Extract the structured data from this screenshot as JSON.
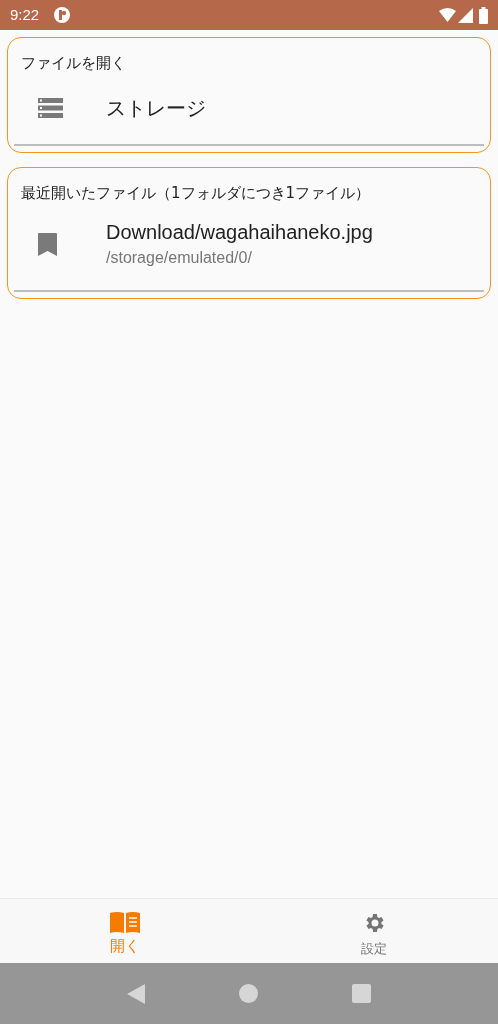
{
  "status_bar": {
    "time": "9:22"
  },
  "sections": [
    {
      "title": "ファイルを開く",
      "items": [
        {
          "kind": "storage",
          "label": "ストレージ"
        }
      ]
    },
    {
      "title": "最近開いたファイル（1フォルダにつき1ファイル）",
      "items": [
        {
          "kind": "bookmark",
          "label": "Download/wagahaihaneko.jpg",
          "sublabel": "/storage/emulated/0/"
        }
      ]
    }
  ],
  "bottom_nav": [
    {
      "kind": "open",
      "label": "開く",
      "selected": true
    },
    {
      "kind": "settings",
      "label": "設定",
      "selected": false
    }
  ]
}
